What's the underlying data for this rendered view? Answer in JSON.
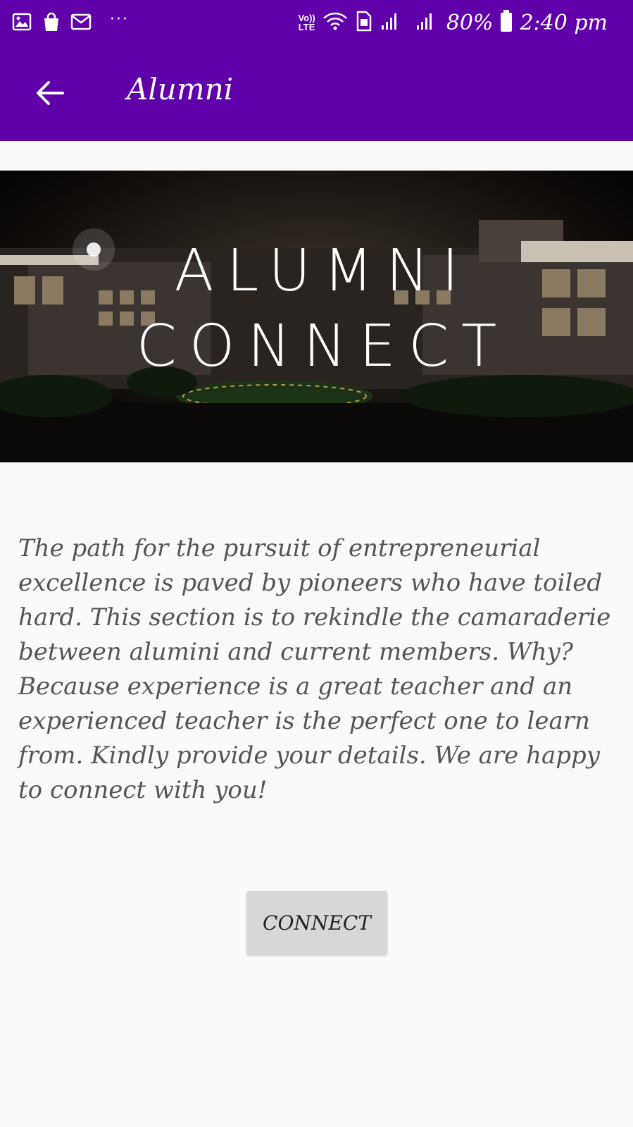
{
  "status_bar": {
    "left_icons": [
      "image-icon",
      "shopping-bag-icon",
      "mail-icon"
    ],
    "overflow": "···",
    "volte_line1": "Vo))",
    "volte_line2": "LTE",
    "battery_percent": "80%",
    "time": "2:40 pm"
  },
  "app_bar": {
    "title": "Alumni",
    "back_icon": "arrow-back-icon"
  },
  "banner": {
    "line1": "ALUMNI",
    "line2": "CONNECT"
  },
  "description": "The path for the pursuit of entrepreneurial excellence is paved by pioneers who have toiled hard. This section is to rekindle the camaraderie between alumini and current members. Why? Because experience is a great teacher and an experienced teacher is the perfect one to learn from. Kindly provide your details. We are happy to connect with you!",
  "connect_button": {
    "label": "CONNECT"
  },
  "colors": {
    "primary": "#6000ab",
    "background": "#fafafa",
    "button": "#d7d7d7",
    "body_text": "#555555"
  }
}
